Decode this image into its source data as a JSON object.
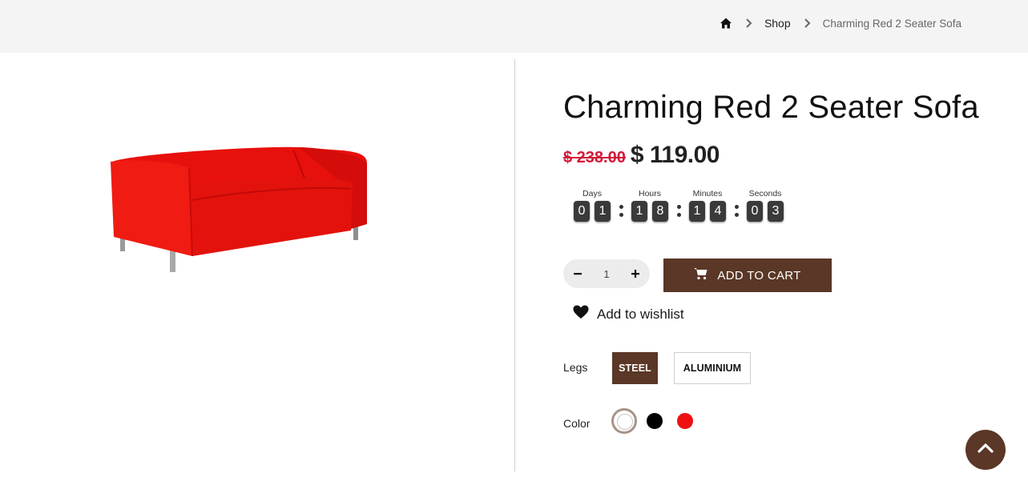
{
  "breadcrumb": {
    "home_icon": "home-icon",
    "separator_icon": "chevron-right-icon",
    "shop": "Shop",
    "current": "Charming Red 2 Seater Sofa"
  },
  "product": {
    "title": "Charming Red 2 Seater Sofa",
    "old_price": "$ 238.00",
    "price": "$ 119.00",
    "image": "red-sofa-image"
  },
  "countdown": {
    "units": [
      {
        "label": "Days",
        "digits": [
          "0",
          "1"
        ]
      },
      {
        "label": "Hours",
        "digits": [
          "1",
          "8"
        ]
      },
      {
        "label": "Minutes",
        "digits": [
          "1",
          "4"
        ]
      },
      {
        "label": "Seconds",
        "digits": [
          "0",
          "3"
        ]
      }
    ]
  },
  "cart": {
    "quantity": "1",
    "minus_icon": "minus-icon",
    "plus_icon": "plus-icon",
    "add_label": "ADD TO CART",
    "cart_icon": "shopping-cart-icon"
  },
  "wishlist": {
    "label": "Add to wishlist",
    "icon": "heart-icon"
  },
  "options": {
    "legs_label": "Legs",
    "legs": [
      "STEEL",
      "ALUMINIUM"
    ],
    "legs_selected": "STEEL",
    "color_label": "Color",
    "colors": [
      "#ffffff",
      "#000000",
      "#ee1111"
    ],
    "color_selected": "#ffffff"
  },
  "colors": {
    "accent": "#5a3726",
    "sale_price": "#d11a3a",
    "topbar_bg": "#f4f4f5"
  },
  "back_to_top_icon": "chevron-up-icon"
}
